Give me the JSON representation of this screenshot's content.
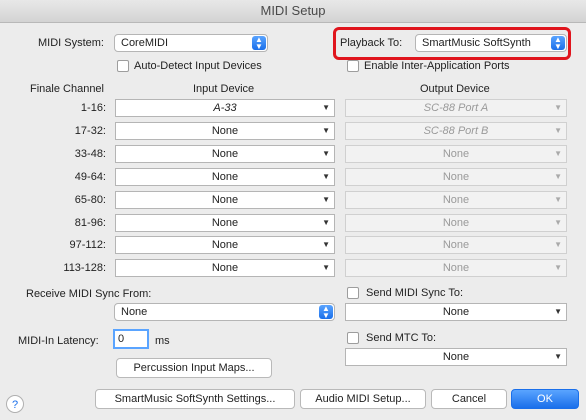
{
  "window": {
    "title": "MIDI Setup"
  },
  "midi_system": {
    "label": "MIDI System:",
    "value": "CoreMIDI"
  },
  "playback": {
    "label": "Playback To:",
    "value": "SmartMusic SoftSynth"
  },
  "auto_detect": {
    "label": "Auto-Detect Input Devices",
    "checked": false
  },
  "inter_app": {
    "label": "Enable Inter-Application Ports",
    "checked": false
  },
  "columns": {
    "channel": "Finale Channel",
    "input": "Input Device",
    "output": "Output Device"
  },
  "rows": [
    {
      "channel": "1-16:",
      "input": "A-33",
      "output": "SC-88 Port A"
    },
    {
      "channel": "17-32:",
      "input": "None",
      "output": "SC-88 Port B"
    },
    {
      "channel": "33-48:",
      "input": "None",
      "output": "None"
    },
    {
      "channel": "49-64:",
      "input": "None",
      "output": "None"
    },
    {
      "channel": "65-80:",
      "input": "None",
      "output": "None"
    },
    {
      "channel": "81-96:",
      "input": "None",
      "output": "None"
    },
    {
      "channel": "97-112:",
      "input": "None",
      "output": "None"
    },
    {
      "channel": "113-128:",
      "input": "None",
      "output": "None"
    }
  ],
  "receive_sync": {
    "label": "Receive MIDI Sync From:",
    "value": "None"
  },
  "send_sync": {
    "label": "Send MIDI Sync To:",
    "value": "None",
    "checked": false
  },
  "latency": {
    "label": "MIDI-In Latency:",
    "value": "0",
    "unit": "ms"
  },
  "send_mtc": {
    "label": "Send MTC To:",
    "value": "None",
    "checked": false
  },
  "buttons": {
    "percussion": "Percussion Input Maps...",
    "softsynth": "SmartMusic SoftSynth Settings...",
    "audio_midi": "Audio MIDI Setup...",
    "cancel": "Cancel",
    "ok": "OK",
    "help": "?"
  },
  "colors": {
    "accent": "#1a6fea",
    "highlight": "#e0151d"
  }
}
